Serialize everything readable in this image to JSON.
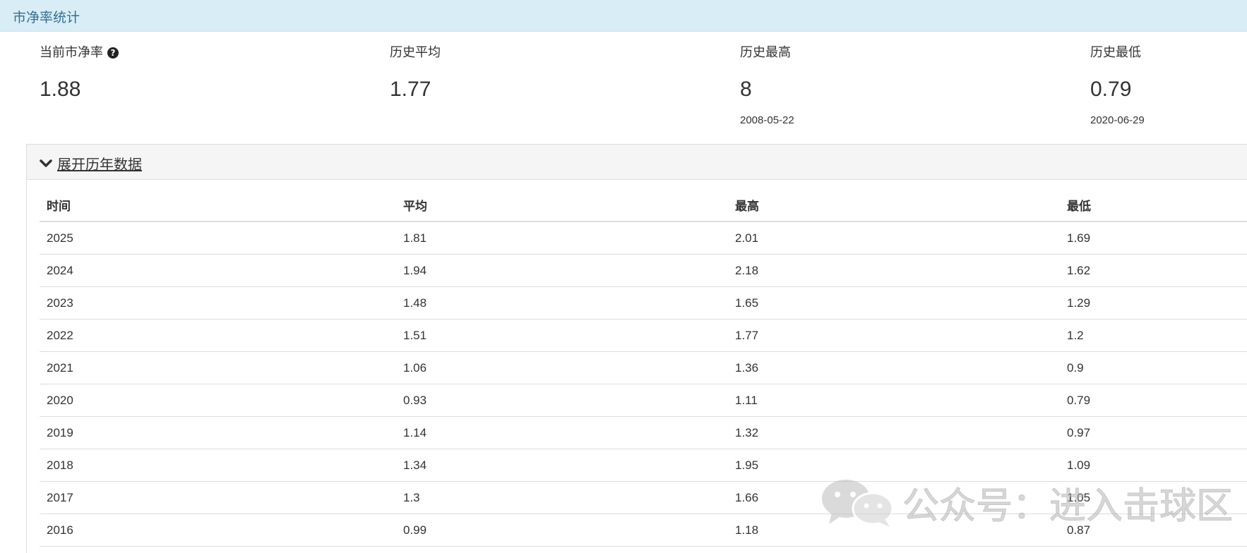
{
  "panel": {
    "title": "市净率统计"
  },
  "stats": [
    {
      "label": "当前市净率",
      "value": "1.88",
      "date": ""
    },
    {
      "label": "历史平均",
      "value": "1.77",
      "date": ""
    },
    {
      "label": "历史最高",
      "value": "8",
      "date": "2008-05-22"
    },
    {
      "label": "历史最低",
      "value": "0.79",
      "date": "2020-06-29"
    }
  ],
  "icons": {
    "help": "question-circle-icon",
    "toggle": "chevron-down-icon",
    "watermark": "wechat-icon"
  },
  "history": {
    "toggle_label": "展开历年数据",
    "columns": [
      "时间",
      "平均",
      "最高",
      "最低"
    ],
    "rows": [
      [
        "2025",
        "1.81",
        "2.01",
        "1.69"
      ],
      [
        "2024",
        "1.94",
        "2.18",
        "1.62"
      ],
      [
        "2023",
        "1.48",
        "1.65",
        "1.29"
      ],
      [
        "2022",
        "1.51",
        "1.77",
        "1.2"
      ],
      [
        "2021",
        "1.06",
        "1.36",
        "0.9"
      ],
      [
        "2020",
        "0.93",
        "1.11",
        "0.79"
      ],
      [
        "2019",
        "1.14",
        "1.32",
        "0.97"
      ],
      [
        "2018",
        "1.34",
        "1.95",
        "1.09"
      ],
      [
        "2017",
        "1.3",
        "1.66",
        "1.05"
      ],
      [
        "2016",
        "0.99",
        "1.18",
        "0.87"
      ]
    ]
  },
  "watermark": {
    "text": "公众号：进入击球区"
  },
  "colors": {
    "heading_bg": "#d9edf7",
    "heading_text": "#31708f",
    "border": "#dddddd",
    "history_heading_bg": "#f5f5f5"
  }
}
